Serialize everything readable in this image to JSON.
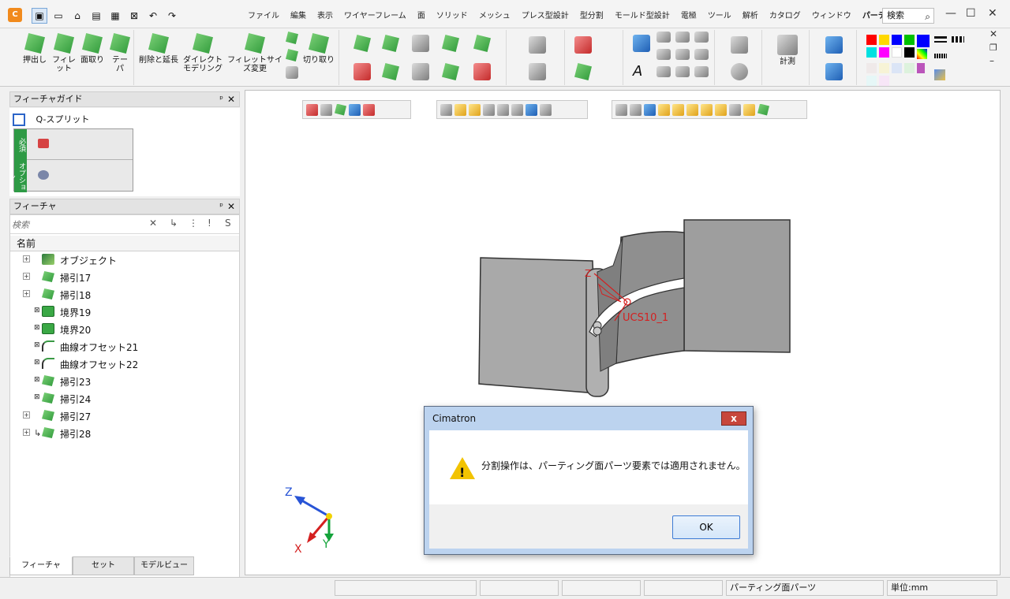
{
  "app": {
    "logo": "C"
  },
  "menu": {
    "items": [
      "ファイル",
      "編集",
      "表示",
      "ワイヤーフレーム",
      "面",
      "ソリッド",
      "メッシュ",
      "プレス型設計",
      "型分割",
      "モールド型設計",
      "電極",
      "ツール",
      "解析",
      "カタログ",
      "ウィンドウ"
    ],
    "current_part": "パーティング面…",
    "search_label": "検索"
  },
  "ribbon": {
    "buttons": {
      "extrude": "押出し",
      "fillet": "フィレット",
      "chamfer": "面取り",
      "taper": "テーパ",
      "delete_extend": "削除と延長",
      "direct_modeling": "ダイレクトモデリング",
      "fillet_resize": "フィレットサイズ変更",
      "cut": "切り取り",
      "measure": "計測"
    },
    "colors": [
      "#ff0000",
      "#ffd800",
      "#0000ff",
      "#00c000",
      "#0000ff",
      "#00e0e0",
      "#ff00ff",
      "#ffffff",
      "#000000",
      "#00c000"
    ]
  },
  "feature_guide": {
    "title": "フィーチャガイド",
    "current": "Q-スプリット",
    "required_tab": "必須",
    "optional_tab": "オプション"
  },
  "feature_tree": {
    "title": "フィーチャ",
    "search_placeholder": "検索",
    "column": "名前",
    "items": [
      {
        "label": "オブジェクト",
        "expandable": true
      },
      {
        "label": "掃引17",
        "expandable": true
      },
      {
        "label": "掃引18",
        "expandable": true
      },
      {
        "label": "境界19",
        "expandable": false
      },
      {
        "label": "境界20",
        "expandable": false
      },
      {
        "label": "曲線オフセット21",
        "expandable": false
      },
      {
        "label": "曲線オフセット22",
        "expandable": false
      },
      {
        "label": "掃引23",
        "expandable": false
      },
      {
        "label": "掃引24",
        "expandable": false
      },
      {
        "label": "掃引27",
        "expandable": true
      },
      {
        "label": "掃引28",
        "expandable": true
      }
    ]
  },
  "bottom_tabs": [
    "フィーチャ",
    "セット",
    "モデルビュー"
  ],
  "viewport": {
    "ucs_label": "UCS10_1",
    "axis_x": "X",
    "axis_y": "Y",
    "axis_z": "Z"
  },
  "statusbar": {
    "mode": "パーティング面パーツ",
    "units": "単位:mm"
  },
  "dialog": {
    "title": "Cimatron",
    "message": "分割操作は、パーティング面パーツ要素では適用されません。",
    "ok": "OK",
    "close": "x"
  }
}
